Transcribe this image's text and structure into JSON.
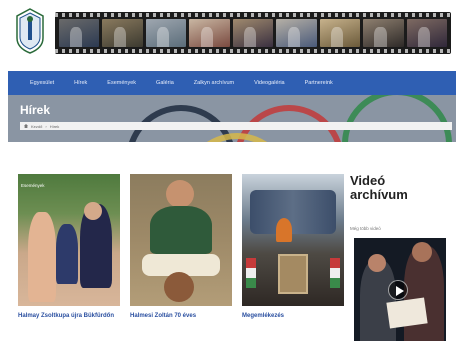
{
  "nav": {
    "items": [
      "Egyesület",
      "Hírek",
      "Események",
      "Galéria",
      "Zalkyn archívum",
      "Videogaléria",
      "Partnereink"
    ]
  },
  "banner": {
    "title": "Hírek",
    "breadcrumb": [
      "Kezdő",
      "Hírek"
    ]
  },
  "articles": [
    {
      "title": "Halmay Zsoltkupa újra Bükfürdőn",
      "tag": "Események"
    },
    {
      "title": "Halmesi Zoltán 70 éves",
      "tag": ""
    },
    {
      "title": "Megemlékezés",
      "tag": ""
    }
  ],
  "video": {
    "heading_line1": "Videó",
    "heading_line2": "archívum",
    "label": "Még több videó"
  },
  "colors": {
    "nav": "#2f5fb3",
    "link": "#2a4fa0",
    "banner": "#8a95a3"
  },
  "icons": [
    "logo-emblem",
    "home-icon",
    "play-icon"
  ]
}
